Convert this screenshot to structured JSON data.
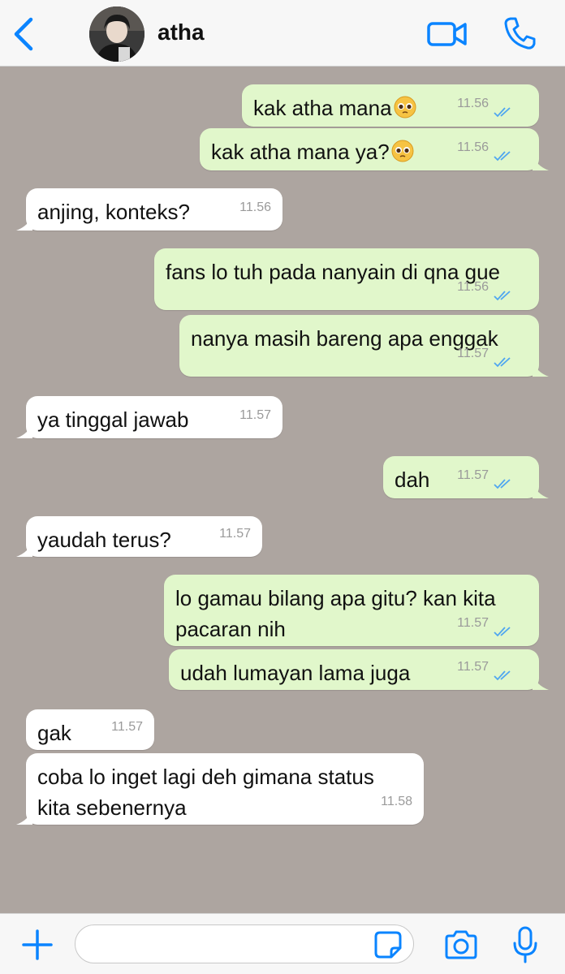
{
  "header": {
    "contact_name": "atha"
  },
  "messages": [
    {
      "direction": "out",
      "lines": [
        "kak atha mana"
      ],
      "emoji": "pleading-face",
      "time": "11.56",
      "status": "read"
    },
    {
      "direction": "out",
      "lines": [
        "kak atha mana ya?"
      ],
      "emoji": "pleading-face",
      "time": "11.56",
      "status": "read"
    },
    {
      "direction": "in",
      "lines": [
        "anjing, konteks?"
      ],
      "time": "11.56"
    },
    {
      "direction": "out",
      "lines": [
        "fans lo tuh pada nanyain di qna gue"
      ],
      "time": "11.56",
      "status": "read"
    },
    {
      "direction": "out",
      "lines": [
        "nanya masih bareng apa enggak"
      ],
      "time": "11.57",
      "status": "read"
    },
    {
      "direction": "in",
      "lines": [
        "ya tinggal jawab"
      ],
      "time": "11.57"
    },
    {
      "direction": "out",
      "lines": [
        "dah"
      ],
      "time": "11.57",
      "status": "read"
    },
    {
      "direction": "in",
      "lines": [
        "yaudah terus?"
      ],
      "time": "11.57"
    },
    {
      "direction": "out",
      "lines": [
        "lo gamau bilang apa gitu? kan kita",
        "pacaran nih"
      ],
      "time": "11.57",
      "status": "read"
    },
    {
      "direction": "out",
      "lines": [
        "udah lumayan lama juga"
      ],
      "time": "11.57",
      "status": "read"
    },
    {
      "direction": "in",
      "lines": [
        "gak"
      ],
      "time": "11.57"
    },
    {
      "direction": "in",
      "lines": [
        "coba lo inget lagi deh gimana status",
        "kita sebenernya"
      ],
      "time": "11.58"
    }
  ],
  "composer": {
    "placeholder": ""
  },
  "colors": {
    "accent": "#0a84ff",
    "outgoing_bubble": "#e1f7cb",
    "incoming_bubble": "#ffffff",
    "chat_background": "#ada5a0",
    "read_ticks": "#4fa6f0"
  }
}
